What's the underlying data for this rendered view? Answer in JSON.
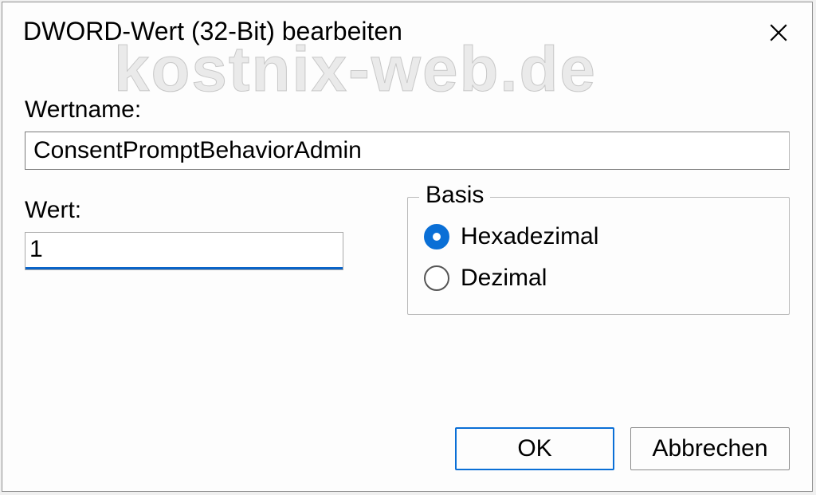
{
  "dialog": {
    "title": "DWORD-Wert (32-Bit) bearbeiten",
    "name_label": "Wertname:",
    "name_value": "ConsentPromptBehaviorAdmin",
    "value_label": "Wert:",
    "value_value": "1",
    "basis": {
      "legend": "Basis",
      "options": [
        {
          "label": "Hexadezimal",
          "checked": true
        },
        {
          "label": "Dezimal",
          "checked": false
        }
      ]
    },
    "ok_label": "OK",
    "cancel_label": "Abbrechen"
  },
  "watermark": "kostnix-web.de"
}
